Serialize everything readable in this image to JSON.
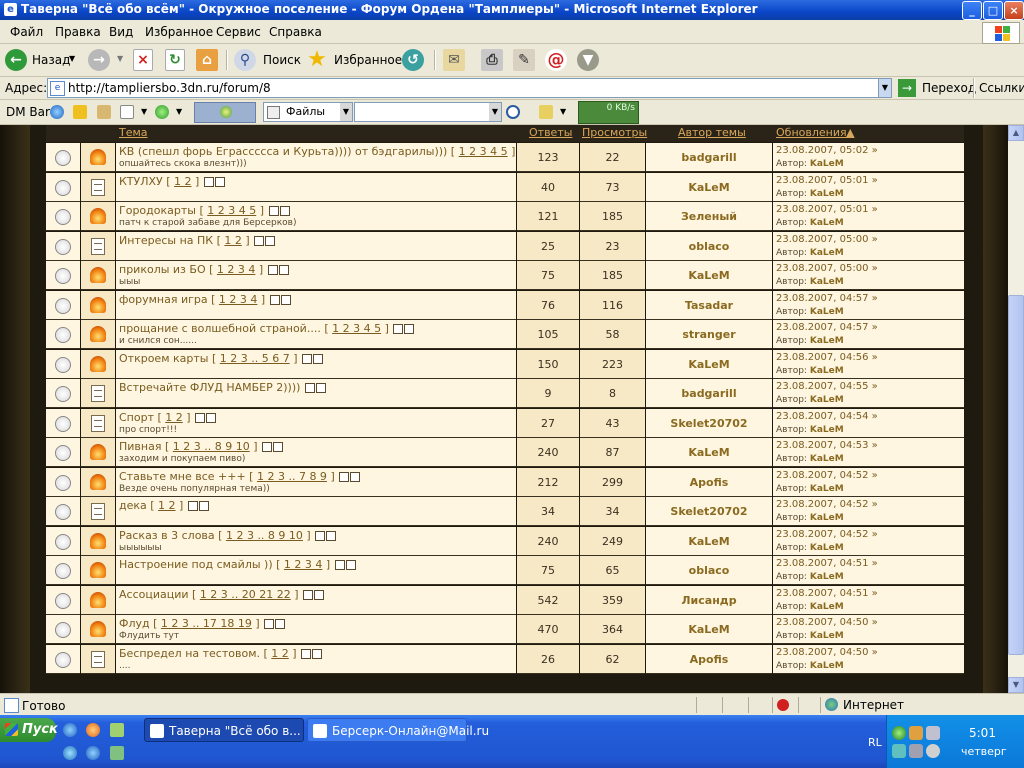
{
  "window": {
    "title": "Таверна \"Всё обо всём\" - Окружное поселение - Форум Ордена \"Тамплиеры\" - Microsoft Internet Explorer"
  },
  "menu": [
    "Файл",
    "Правка",
    "Вид",
    "Избранное",
    "Сервис",
    "Справка"
  ],
  "toolbar": {
    "back": "Назад",
    "search": "Поиск",
    "favorites": "Избранное"
  },
  "address": {
    "label": "Адрес:",
    "url": "http://tampliersbo.3dn.ru/forum/8",
    "go": "Переход",
    "links": "Ссылки"
  },
  "dmbar": {
    "label": "DM Bar",
    "files": "Файлы",
    "speed": "0 KB/s"
  },
  "table": {
    "headers": {
      "topic": "Тема",
      "replies": "Ответы",
      "views": "Просмотры",
      "author": "Автор темы",
      "updates": "Обновления"
    },
    "last_prefix": "Автор:",
    "rows": [
      {
        "hot": true,
        "title": "КВ (спешл форь Еграссссса и Курьта)))) от бэдгарилы))) [",
        "pages": "1 2 3 4 5",
        "desc": "опшайтесь скока влезнт)))",
        "replies": "123",
        "views": "22",
        "author": "badgarill",
        "date": "23.08.2007, 05:02",
        "last": "KaLeM"
      },
      {
        "hot": false,
        "title": "КТУЛХУ [",
        "pages": "1 2",
        "desc": "",
        "replies": "40",
        "views": "73",
        "author": "KaLeM",
        "date": "23.08.2007, 05:01",
        "last": "KaLeM"
      },
      {
        "hot": true,
        "title": "Городокарты [",
        "pages": "1 2 3 4 5",
        "desc": "патч к старой забаве для Берсерков)",
        "replies": "121",
        "views": "185",
        "author": "Зеленый",
        "date": "23.08.2007, 05:01",
        "last": "KaLeM"
      },
      {
        "hot": false,
        "title": "Интересы на ПК [",
        "pages": "1 2",
        "desc": "",
        "replies": "25",
        "views": "23",
        "author": "oblaco",
        "date": "23.08.2007, 05:00",
        "last": "KaLeM"
      },
      {
        "hot": true,
        "title": "приколы из БО [",
        "pages": "1 2 3 4",
        "desc": "ыыы",
        "replies": "75",
        "views": "185",
        "author": "KaLeM",
        "date": "23.08.2007, 05:00",
        "last": "KaLeM"
      },
      {
        "hot": true,
        "title": "форумная игра [",
        "pages": "1 2 3 4",
        "desc": "",
        "replies": "76",
        "views": "116",
        "author": "Tasadar",
        "date": "23.08.2007, 04:57",
        "last": "KaLeM"
      },
      {
        "hot": true,
        "title": "прощание с волшебной страной.... [",
        "pages": "1 2 3 4 5",
        "desc": "и снился сон......",
        "replies": "105",
        "views": "58",
        "author": "stranger",
        "date": "23.08.2007, 04:57",
        "last": "KaLeM"
      },
      {
        "hot": true,
        "title": "Откроем карты [",
        "pages": "1 2 3 .. 5 6 7",
        "desc": "",
        "replies": "150",
        "views": "223",
        "author": "KaLeM",
        "date": "23.08.2007, 04:56",
        "last": "KaLeM"
      },
      {
        "hot": false,
        "title": "Встречайте ФЛУД НАМБЕР 2)))) ",
        "pages": "",
        "desc": "",
        "replies": "9",
        "views": "8",
        "author": "badgarill",
        "date": "23.08.2007, 04:55",
        "last": "KaLeM"
      },
      {
        "hot": false,
        "title": "Спорт [",
        "pages": "1 2",
        "desc": "про спорт!!!",
        "replies": "27",
        "views": "43",
        "author": "Skelet20702",
        "date": "23.08.2007, 04:54",
        "last": "KaLeM"
      },
      {
        "hot": true,
        "title": "Пивная [",
        "pages": "1 2 3 .. 8 9 10",
        "desc": "заходим и покупаем пиво)",
        "replies": "240",
        "views": "87",
        "author": "KaLeM",
        "date": "23.08.2007, 04:53",
        "last": "KaLeM"
      },
      {
        "hot": true,
        "title": "Ставьте мне все +++ [",
        "pages": "1 2 3 .. 7 8 9",
        "desc": "Везде очень популярная тема))",
        "replies": "212",
        "views": "299",
        "author": "Apofis",
        "date": "23.08.2007, 04:52",
        "last": "KaLeM"
      },
      {
        "hot": false,
        "title": "дека [",
        "pages": "1 2",
        "desc": "",
        "replies": "34",
        "views": "34",
        "author": "Skelet20702",
        "date": "23.08.2007, 04:52",
        "last": "KaLeM"
      },
      {
        "hot": true,
        "title": "Расказ в 3 слова [",
        "pages": "1 2 3 .. 8 9 10",
        "desc": "ыыыыыы",
        "replies": "240",
        "views": "249",
        "author": "KaLeM",
        "date": "23.08.2007, 04:52",
        "last": "KaLeM"
      },
      {
        "hot": true,
        "title": "Настроение под смайлы )) [",
        "pages": "1 2 3 4",
        "desc": "",
        "replies": "75",
        "views": "65",
        "author": "oblaco",
        "date": "23.08.2007, 04:51",
        "last": "KaLeM"
      },
      {
        "hot": true,
        "title": "Ассоциации [",
        "pages": "1 2 3 .. 20 21 22",
        "desc": "",
        "replies": "542",
        "views": "359",
        "author": "Лисандр",
        "date": "23.08.2007, 04:51",
        "last": "KaLeM"
      },
      {
        "hot": true,
        "title": "Флуд [",
        "pages": "1 2 3 .. 17 18 19",
        "desc": "Флудить тут",
        "replies": "470",
        "views": "364",
        "author": "KaLeM",
        "date": "23.08.2007, 04:50",
        "last": "KaLeM"
      },
      {
        "hot": false,
        "title": "Беспредел на тестовом. [",
        "pages": "1 2",
        "desc": "....",
        "replies": "26",
        "views": "62",
        "author": "Apofis",
        "date": "23.08.2007, 04:50",
        "last": "KaLeM"
      }
    ]
  },
  "status": {
    "text": "Готово",
    "zone": "Интернет"
  },
  "taskbar": {
    "start": "Пуск",
    "tasks": [
      "Таверна \"Всё обо в...",
      "Берсерк-Онлайн@Mail.ru"
    ],
    "lang": "RL",
    "clock": "5:01",
    "day": "четверг"
  }
}
